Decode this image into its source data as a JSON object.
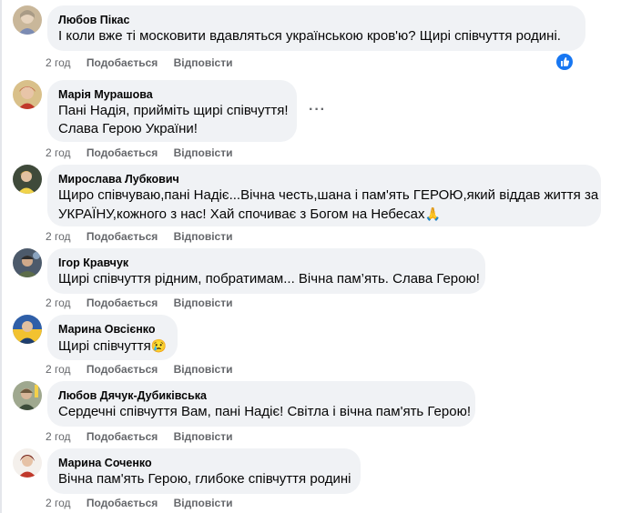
{
  "comments": [
    {
      "author": "Любов Пікас",
      "lines": [
        "І коли вже ті московити вдавляться українською кров'ю? Щирі співчуття родині."
      ],
      "time": "2 год",
      "like": "Подобається",
      "reply": "Відповісти"
    },
    {
      "author": "Марія Мурашова",
      "lines": [
        "Пані Надія, прийміть щирі співчуття!",
        "Слава Герою України!"
      ],
      "time": "2 год",
      "like": "Подобається",
      "reply": "Відповісти"
    },
    {
      "author": "Мирослава Лубкович",
      "lines": [
        "Щиро співчуваю,пані Надіє...Вічна честь,шана і пам'ять ГЕРОЮ,який віддав життя за",
        "УКРАЇНУ,кожного з нас! Хай спочиває з Богом на Небесах"
      ],
      "emoji": "🙏",
      "time": "2 год",
      "like": "Подобається",
      "reply": "Відповісти"
    },
    {
      "author": "Ігор Кравчук",
      "lines": [
        "Щирі співчуття рідним, побратимам... Вічна пам’ять. Слава Герою!"
      ],
      "time": "2 год",
      "like": "Подобається",
      "reply": "Відповісти"
    },
    {
      "author": "Марина Овсієнко",
      "lines": [
        "Щирі співчуття"
      ],
      "emoji": "😢",
      "time": "2 год",
      "like": "Подобається",
      "reply": "Відповісти"
    },
    {
      "author": "Любов Дячук-Дубиківська",
      "lines": [
        "Сердечні співчуття Вам, пані Надіє! Світла і вічна пам'ять Герою!"
      ],
      "time": "2 год",
      "like": "Подобається",
      "reply": "Відповісти"
    },
    {
      "author": "Марина Соченко",
      "lines": [
        "Вічна пам'ять Герою, глибоке співчуття родині"
      ],
      "time": "2 год",
      "like": "Подобається",
      "reply": "Відповісти"
    }
  ],
  "icons": {
    "more": "more-options-icon",
    "like_badge": "like-thumb-icon"
  },
  "colors": {
    "bubble": "#f0f2f5",
    "secondary_text": "#65676b",
    "like_blue": "#1877f2"
  }
}
